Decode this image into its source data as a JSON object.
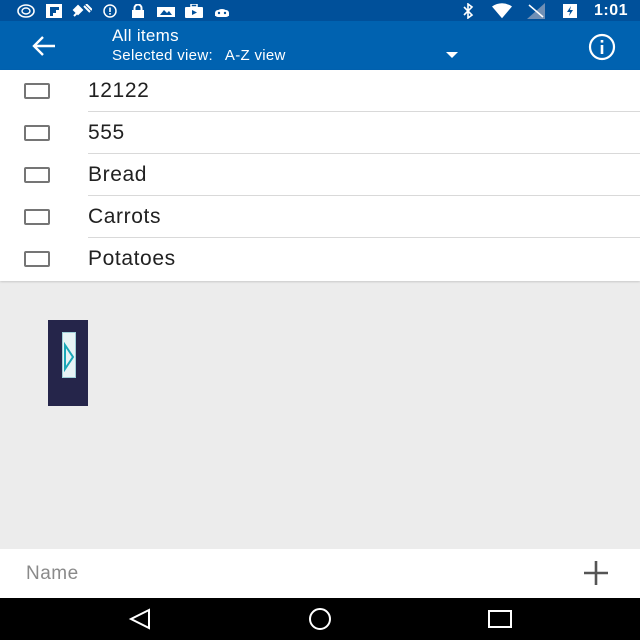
{
  "status_bar": {
    "time": "1:01",
    "left_icons": [
      "sync-icon",
      "flipboard-icon",
      "satellite-icon",
      "alert-icon",
      "lock-icon",
      "photos-icon",
      "briefcase-icon",
      "android-icon"
    ],
    "right_icons": [
      "bluetooth-icon",
      "wifi-icon",
      "signal-icon",
      "battery-charging-icon"
    ]
  },
  "app_bar": {
    "title": "All items",
    "subtitle_label": "Selected view:",
    "selected_view": "A-Z view"
  },
  "items": [
    {
      "label": "12122",
      "checked": false
    },
    {
      "label": "555",
      "checked": false
    },
    {
      "label": "Bread",
      "checked": false
    },
    {
      "label": "Carrots",
      "checked": false
    },
    {
      "label": "Potatoes",
      "checked": false
    }
  ],
  "input": {
    "placeholder": "Name",
    "value": ""
  },
  "colors": {
    "status_bar": "#00509a",
    "app_bar": "#0062b0",
    "background": "#ececec"
  }
}
